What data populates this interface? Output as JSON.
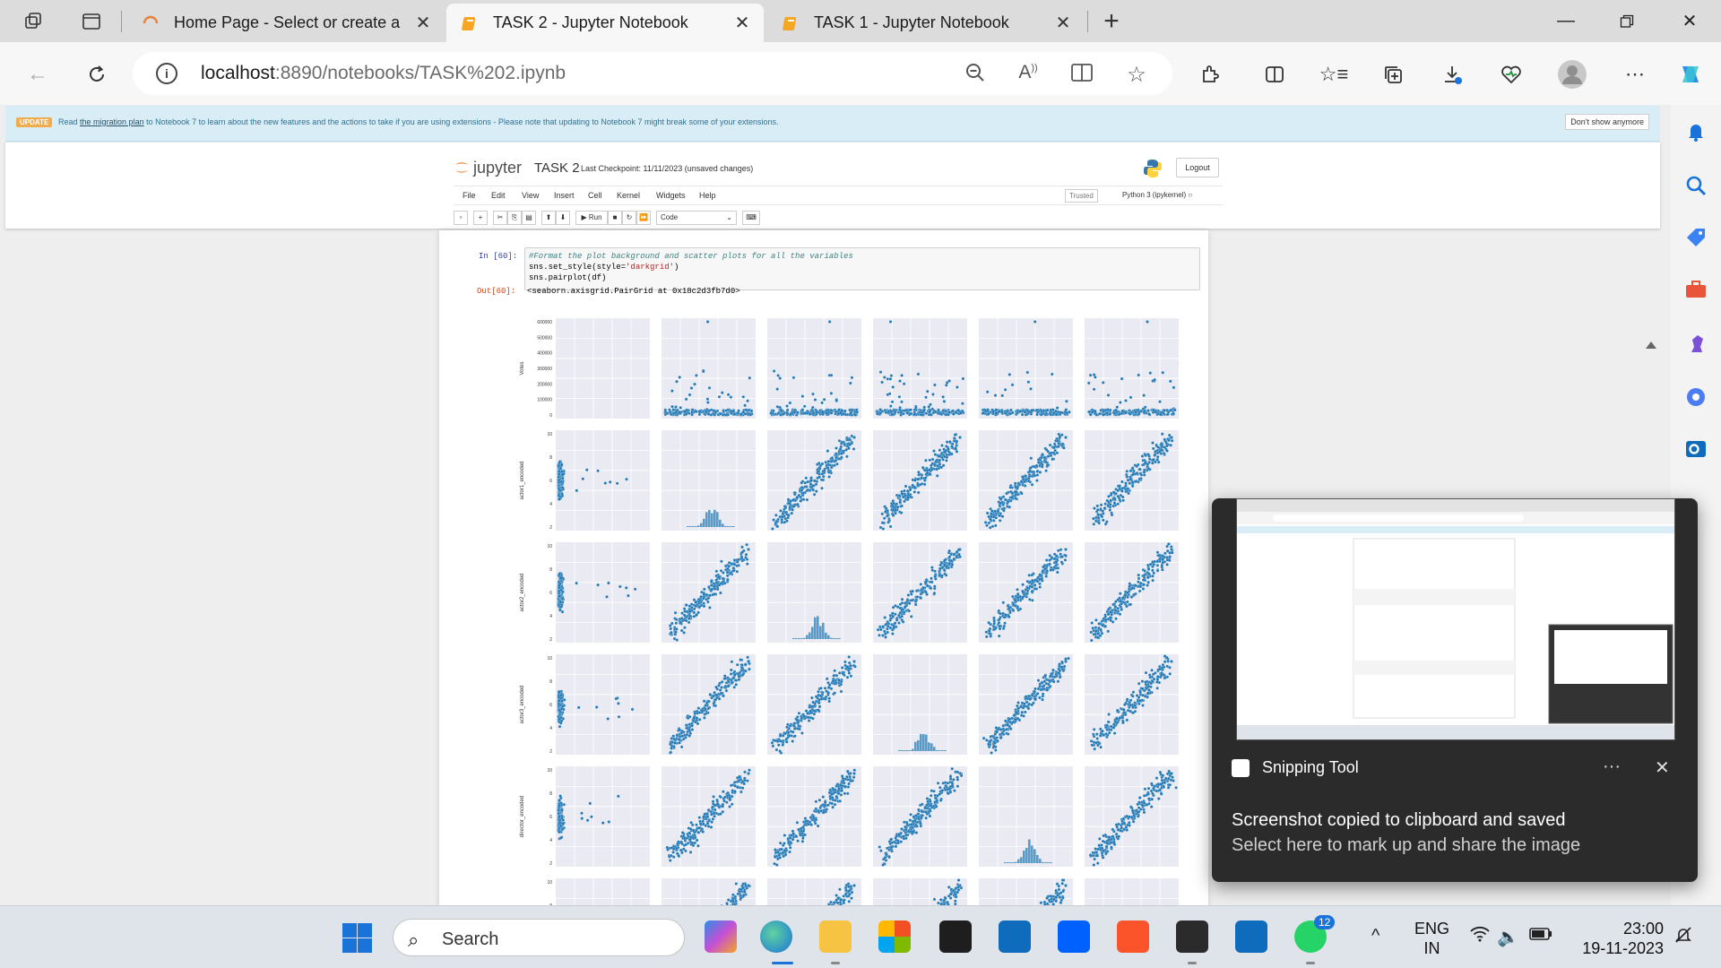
{
  "browser": {
    "tabs": [
      {
        "title": "Home Page - Select or create a n",
        "active": false
      },
      {
        "title": "TASK 2 - Jupyter Notebook",
        "active": true
      },
      {
        "title": "TASK 1 - Jupyter Notebook",
        "active": false
      }
    ],
    "url_host": "localhost",
    "url_rest": ":8890/notebooks/TASK%202.ipynb"
  },
  "banner": {
    "label": "UPDATE",
    "text_before": "Read ",
    "link": "the migration plan",
    "text_after": " to Notebook 7 to learn about the new features and the actions to take if you are using extensions - Please note that updating to Notebook 7 might break some of your extensions.",
    "dismiss": "Don't show anymore"
  },
  "notebook": {
    "brand": "jupyter",
    "title": "TASK 2",
    "checkpoint": "Last Checkpoint: 11/11/2023  (unsaved changes)",
    "logout": "Logout",
    "menu": [
      "File",
      "Edit",
      "View",
      "Insert",
      "Cell",
      "Kernel",
      "Widgets",
      "Help"
    ],
    "trusted": "Trusted",
    "kernel": "Python 3 (ipykernel)",
    "run_label": "Run",
    "cell_type": "Code",
    "in_prompt": "In [60]:",
    "out_prompt": "Out[60]:",
    "code_comment": "#Format the plot background and scatter plots for all the variables",
    "code_line2_a": "sns.set_style(style=",
    "code_line2_str": "'darkgrid'",
    "code_line2_b": ")",
    "code_line3": "sns.pairplot(df)",
    "output_text": "<seaborn.axisgrid.PairGrid at 0x18c2d3fb7d0>"
  },
  "chart_data": {
    "type": "scatter",
    "title": "",
    "row_labels": [
      "Votes",
      "actor1_encoded",
      "actor2_encoded",
      "actor3_encoded",
      "director_encoded",
      ""
    ],
    "votes_ticks": [
      "600000",
      "500000",
      "400000",
      "300000",
      "200000",
      "100000",
      "0"
    ],
    "encoded_ticks": [
      "10",
      "8",
      "6",
      "4",
      "2"
    ],
    "grid": true,
    "style": "darkgrid",
    "color": "#1f77b4"
  },
  "toast": {
    "app": "Snipping Tool",
    "line1": "Screenshot copied to clipboard and saved",
    "line2": "Select here to mark up and share the image"
  },
  "taskbar": {
    "search": "Search",
    "lang1": "ENG",
    "lang2": "IN",
    "time": "23:00",
    "date": "19-11-2023",
    "whatsapp_badge": "12"
  }
}
